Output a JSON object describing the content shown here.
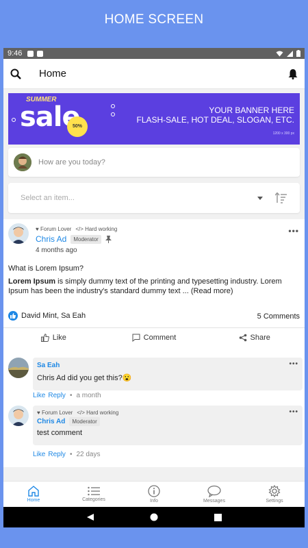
{
  "caption": "HOME SCREEN",
  "statusbar": {
    "time": "9:46"
  },
  "appbar": {
    "title": "Home"
  },
  "banner": {
    "summer": "SUMMER",
    "sale": "sale",
    "badge": "50%",
    "line1": "YOUR BANNER HERE",
    "line2": "FLASH-SALE, HOT DEAL, SLOGAN, ETC.",
    "dims": "1200 x 300 px",
    "bg_color": "#5b3fe0"
  },
  "status_input": {
    "placeholder": "How are you today?"
  },
  "select": {
    "placeholder": "Select an item..."
  },
  "post": {
    "tag1": "Forum Lover",
    "tag2": "Hard working",
    "author": "Chris Ad",
    "role": "Moderator",
    "time": "4 months ago",
    "title": "What is Lorem Ipsum?",
    "body_bold": "Lorem Ipsum",
    "body_text": " is simply dummy text of the printing and typesetting industry. Lorem Ipsum has been the industry's standard dummy text ... ",
    "read_more": "(Read more)",
    "likers": "David Mint, Sa Eah",
    "comments_count": "5 Comments",
    "like_label": "Like",
    "comment_label": "Comment",
    "share_label": "Share"
  },
  "comments": [
    {
      "author": "Sa Eah",
      "text": "Chris Ad did you get this?😮",
      "like": "Like",
      "reply": "Reply",
      "sep": "•",
      "time": "a month"
    },
    {
      "author": "Chris Ad",
      "tag1": "Forum Lover",
      "tag2": "Hard working",
      "role": "Moderator",
      "text": "test comment",
      "like": "Like",
      "reply": "Reply",
      "sep": "•",
      "time": "22 days"
    }
  ],
  "bottomnav": [
    {
      "label": "Home",
      "icon": "home-icon"
    },
    {
      "label": "Categories",
      "icon": "list-icon"
    },
    {
      "label": "Info",
      "icon": "info-icon"
    },
    {
      "label": "Messages",
      "icon": "chat-icon"
    },
    {
      "label": "Settings",
      "icon": "gear-icon"
    }
  ],
  "colors": {
    "accent": "#1e88e5",
    "background": "#6a93ee"
  }
}
